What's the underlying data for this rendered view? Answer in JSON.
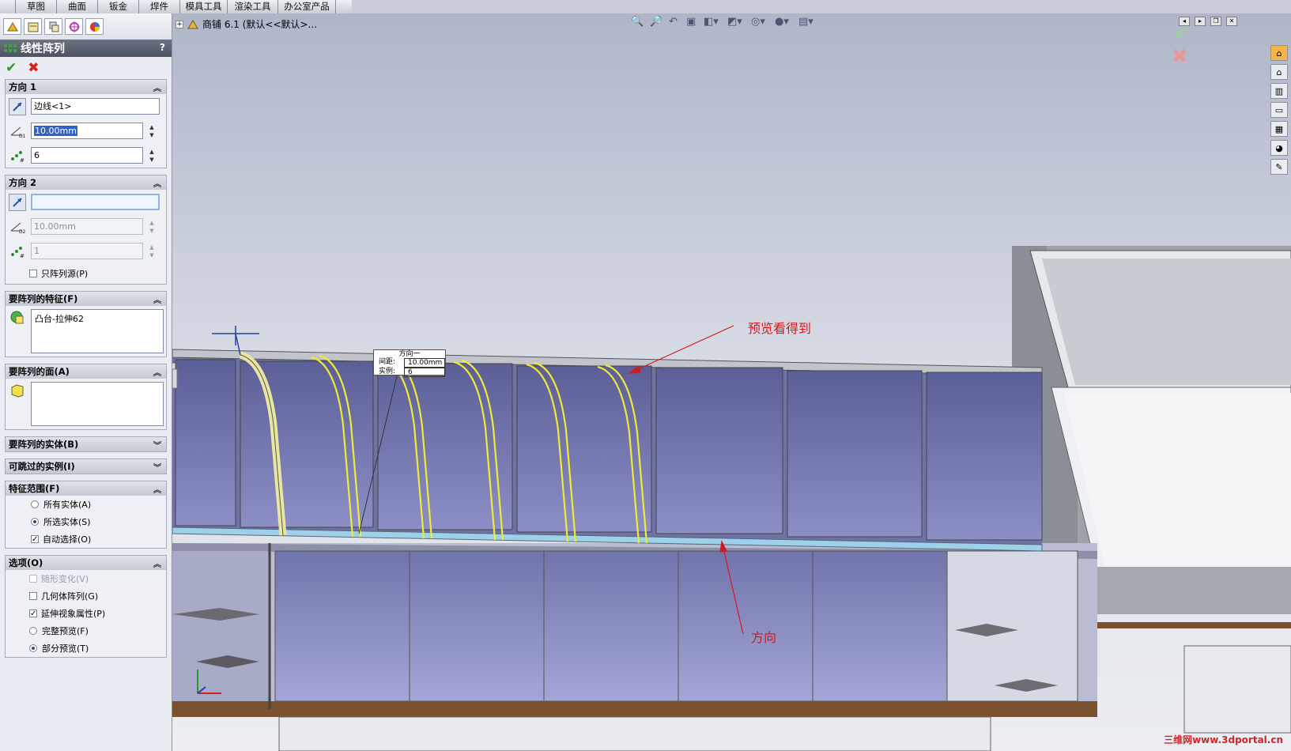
{
  "menu_tabs": [
    "草图",
    "曲面",
    "钣金",
    "焊件",
    "模具工具",
    "渲染工具",
    "办公室产品"
  ],
  "panel": {
    "title": "线性阵列",
    "help": "?",
    "ok_icon": "check-icon",
    "cancel_icon": "close-icon",
    "direction1": {
      "header": "方向 1",
      "edge": "边线<1>",
      "spacing": "10.00mm",
      "instances": "6"
    },
    "direction2": {
      "header": "方向 2",
      "edge": "",
      "spacing": "10.00mm",
      "instances": "1",
      "seed_only": "只阵列源(P)"
    },
    "features": {
      "header": "要阵列的特征(F)",
      "items": [
        "凸台-拉伸62"
      ]
    },
    "faces": {
      "header": "要阵列的面(A)"
    },
    "bodies": {
      "header": "要阵列的实体(B)"
    },
    "skip": {
      "header": "可跳过的实例(I)"
    },
    "scope": {
      "header": "特征范围(F)",
      "all_bodies": "所有实体(A)",
      "selected_bodies": "所选实体(S)",
      "auto_select": "自动选择(O)",
      "selected": "selected_bodies",
      "auto_checked": true
    },
    "options": {
      "header": "选项(O)",
      "vary_sketch": "随形变化(V)",
      "geometry_pattern": "几何体阵列(G)",
      "propagate": "延伸视象属性(P)",
      "full_preview": "完整预览(F)",
      "partial_preview": "部分预览(T)",
      "propagate_checked": true,
      "preview": "partial"
    }
  },
  "viewport": {
    "tree_label": "商铺  6.1  (默认<<默认>...",
    "callout": {
      "title": "方向一",
      "spacing_label": "间距:",
      "spacing_value": "10.00mm",
      "instances_label": "实例:",
      "instances_value": "6"
    },
    "annotation_preview": "预览看得到",
    "annotation_direction": "方向",
    "watermark": "三维网www.3dportal.cn"
  },
  "colors": {
    "accent_arc": "#f0ee3a",
    "annotation": "#d4181f",
    "glass": "#7d82b8"
  }
}
